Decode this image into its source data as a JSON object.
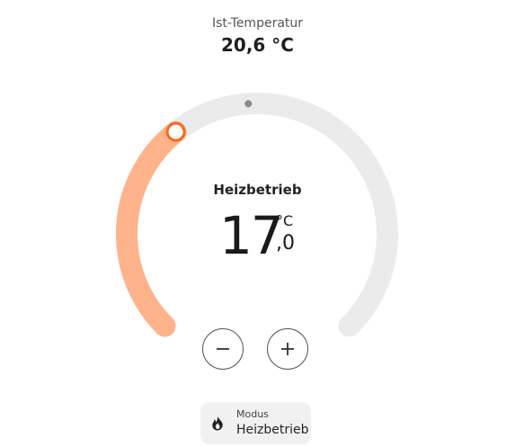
{
  "current": {
    "label": "Ist-Temperatur",
    "value": "20,6 °C"
  },
  "thermostat": {
    "mode": "Heizbetrieb",
    "target_integer": "17",
    "target_decimal": ",0",
    "unit": "°C",
    "target_value": 17.0,
    "current_value": 20.6,
    "range_min": 7,
    "range_max": 35,
    "active_arc_color": "#ffb38a",
    "inactive_arc_color": "#ebebeb",
    "handle_color": "#f36b21"
  },
  "buttons": {
    "decrease_icon": "minus-icon",
    "increase_icon": "plus-icon"
  },
  "mode_chip": {
    "label": "Modus",
    "value": "Heizbetrieb",
    "icon": "flame-icon"
  }
}
